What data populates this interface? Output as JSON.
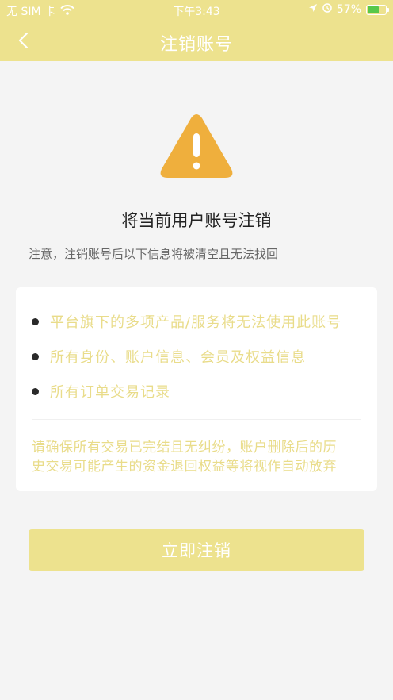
{
  "status_bar": {
    "carrier": "无 SIM 卡",
    "time": "下午3:43",
    "battery": "57%",
    "icons": [
      "wifi-icon",
      "location-arrow-icon",
      "alarm-icon",
      "battery-icon"
    ]
  },
  "nav": {
    "back_icon": "chevron-left-icon",
    "title": "注销账号"
  },
  "main": {
    "warning_icon": "warning-triangle-icon",
    "heading": "将当前用户账号注销",
    "notice": "注意，注销账号后以下信息将被清空且无法找回",
    "items": [
      "平台旗下的多项产品/服务将无法使用此账号",
      "所有身份、账户信息、会员及权益信息",
      "所有订单交易记录"
    ],
    "warning_lines": [
      "请确保所有交易已完结且无纠纷，账户删除后的历",
      "史交易可能产生的资金退回权益等将视作自动放弃"
    ],
    "button_label": "立即注销"
  },
  "colors": {
    "accent": "#ede28e",
    "accent_text": "#e9dc8a",
    "warning_orange": "#efaf3d",
    "background": "#f4f4f4"
  }
}
